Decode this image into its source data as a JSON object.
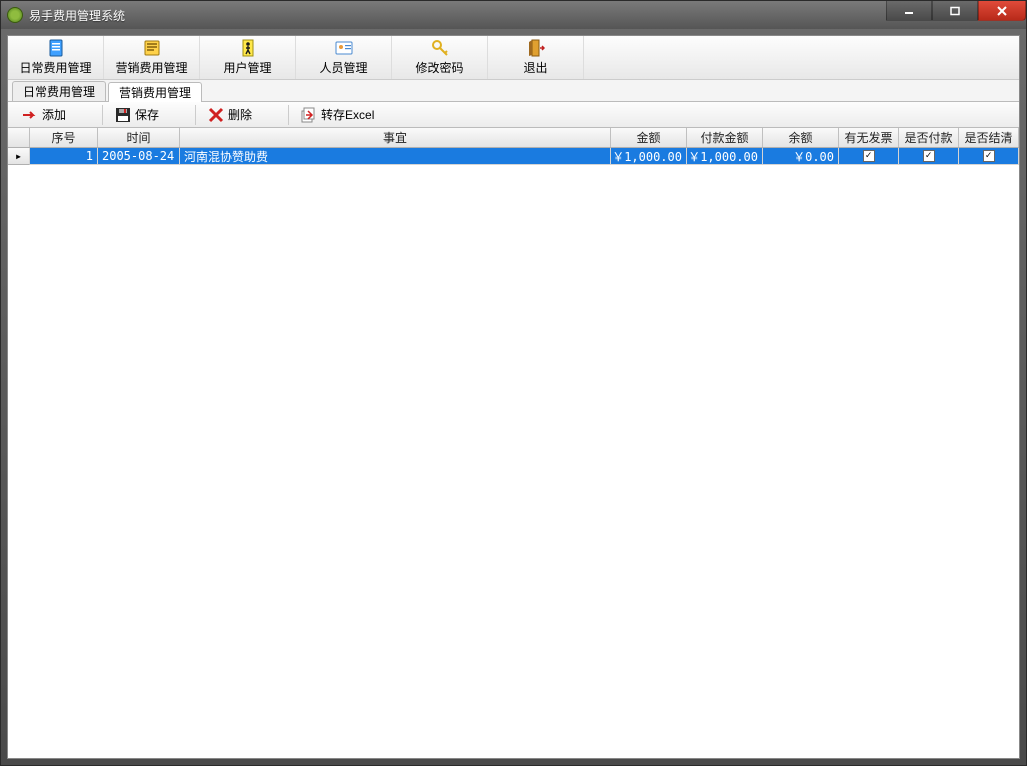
{
  "window": {
    "title": "易手费用管理系统"
  },
  "mainToolbar": [
    {
      "key": "daily",
      "label": "日常费用管理"
    },
    {
      "key": "marketing",
      "label": "营销费用管理"
    },
    {
      "key": "user",
      "label": "用户管理"
    },
    {
      "key": "staff",
      "label": "人员管理"
    },
    {
      "key": "password",
      "label": "修改密码"
    },
    {
      "key": "exit",
      "label": "退出"
    }
  ],
  "tabs": [
    {
      "label": "日常费用管理",
      "active": false
    },
    {
      "label": "营销费用管理",
      "active": true
    }
  ],
  "subToolbar": {
    "add": "添加",
    "save": "保存",
    "delete": "删除",
    "export": "转存Excel"
  },
  "grid": {
    "headers": {
      "seq": "序号",
      "time": "时间",
      "matter": "事宜",
      "amount": "金额",
      "paid": "付款金额",
      "balance": "余额",
      "invoice": "有无发票",
      "ispaid": "是否付款",
      "settled": "是否结清"
    },
    "rows": [
      {
        "seq": "1",
        "time": "2005-08-24",
        "matter": "河南混协赞助费",
        "amount": "￥1,000.00",
        "paid": "￥1,000.00",
        "balance": "￥0.00",
        "invoice": true,
        "ispaid": true,
        "settled": true,
        "selected": true
      }
    ]
  }
}
